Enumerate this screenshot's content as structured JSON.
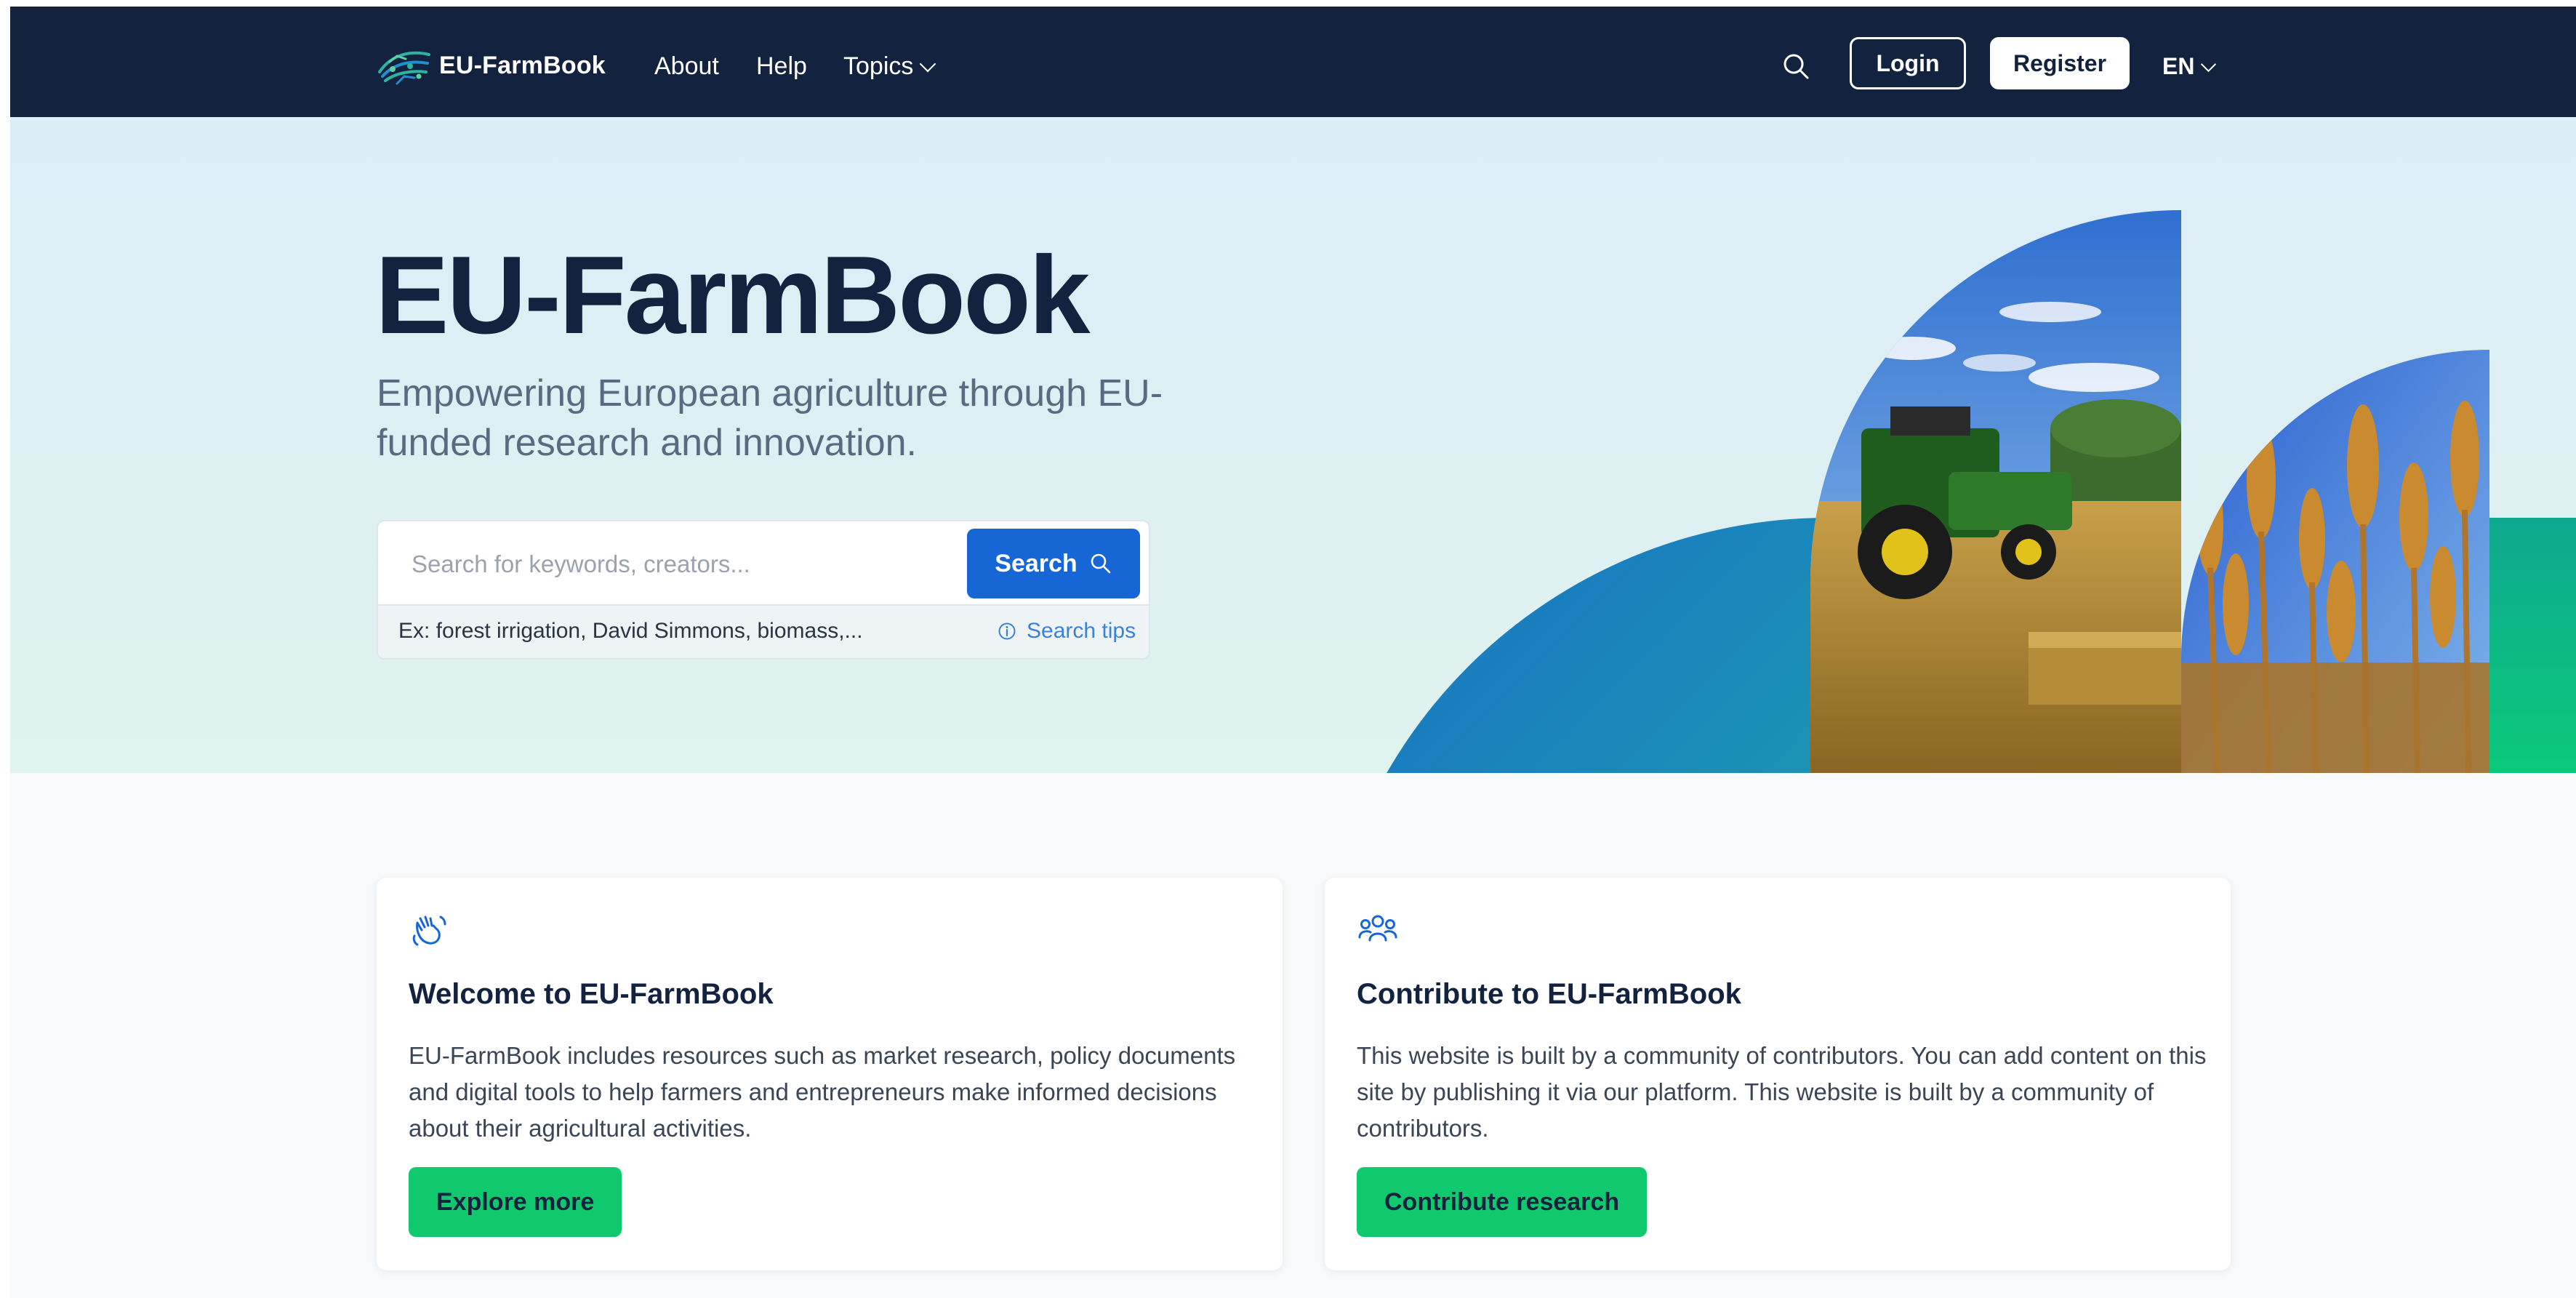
{
  "nav": {
    "brand": "EU-FarmBook",
    "links": [
      "About",
      "Help",
      "Topics"
    ],
    "login": "Login",
    "register": "Register",
    "lang": "EN"
  },
  "hero": {
    "title": "EU-FarmBook",
    "subtitle": "Empowering European agriculture through EU-funded research and innovation.",
    "search_placeholder": "Search for keywords, creators...",
    "search_button": "Search",
    "example": "Ex: forest irrigation, David Simmons, biomass,...",
    "tips": "Search tips"
  },
  "cards": [
    {
      "title": "Welcome to EU-FarmBook",
      "text": "EU-FarmBook includes resources such as market research, policy documents and digital tools to help farmers and entrepreneurs make informed decisions about their agricultural activities.",
      "button": "Explore more",
      "icon": "waving-hand-icon"
    },
    {
      "title": "Contribute to EU-FarmBook",
      "text": "This website is built by a community of contributors. You can add content on this site by publishing it via our platform. This website is built by a community of contributors.",
      "button": "Contribute research",
      "icon": "community-icon"
    }
  ],
  "colors": {
    "nav_bg": "#13233f",
    "primary": "#1766d6",
    "accent_green": "#10c96f"
  }
}
